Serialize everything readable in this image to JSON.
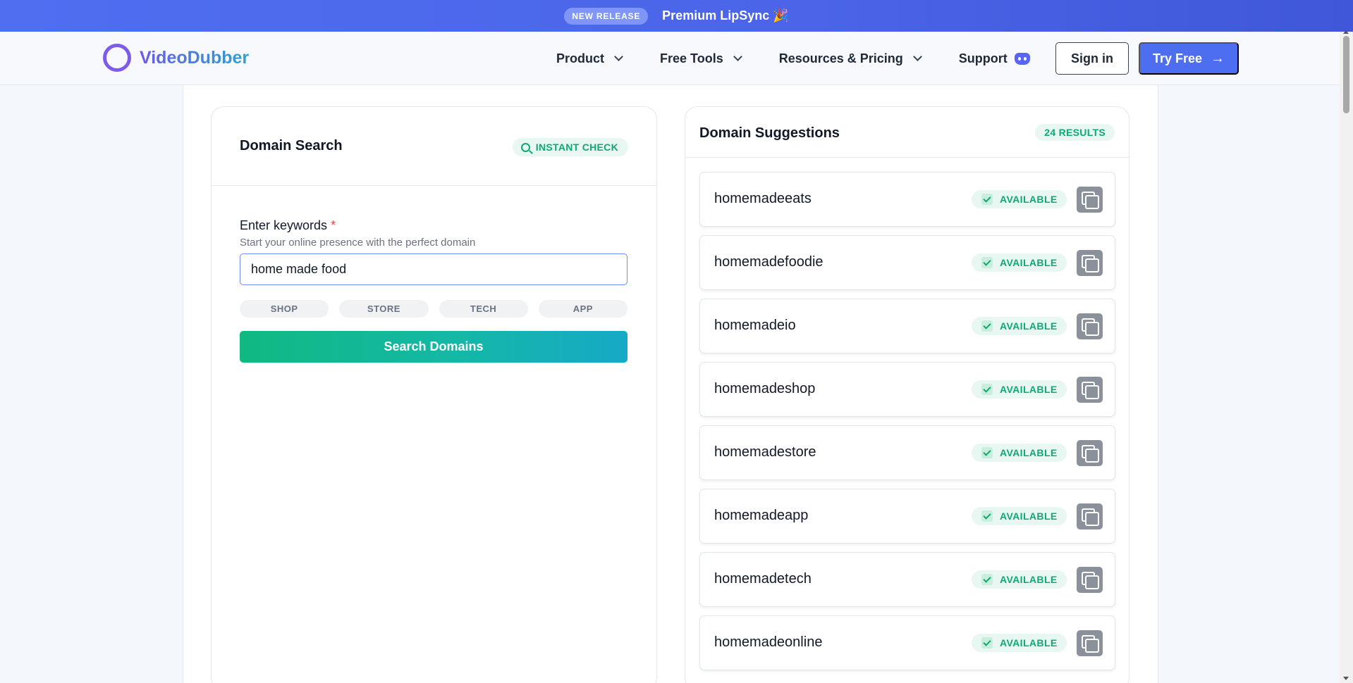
{
  "announcement": {
    "badge": "NEW RELEASE",
    "message": "Premium LipSync 🎉"
  },
  "header": {
    "brand": "VideoDubber",
    "nav": [
      {
        "label": "Product",
        "icon": "chevron-down-icon"
      },
      {
        "label": "Free Tools",
        "icon": "chevron-down-icon"
      },
      {
        "label": "Resources & Pricing",
        "icon": "chevron-down-icon"
      },
      {
        "label": "Support",
        "icon": "discord-icon"
      }
    ],
    "signin_label": "Sign in",
    "tryfree_label": "Try Free"
  },
  "search_panel": {
    "title": "Domain Search",
    "badge": "INSTANT CHECK",
    "field_label": "Enter keywords",
    "required_mark": "*",
    "helper": "Start your online presence with the perfect domain",
    "input_value": "home made food",
    "chips": [
      "SHOP",
      "STORE",
      "TECH",
      "APP"
    ],
    "button_label": "Search Domains"
  },
  "suggestions": {
    "title": "Domain Suggestions",
    "count_label": "24 RESULTS",
    "items": [
      {
        "name": "homemadeeats",
        "status": "AVAILABLE"
      },
      {
        "name": "homemadefoodie",
        "status": "AVAILABLE"
      },
      {
        "name": "homemadeio",
        "status": "AVAILABLE"
      },
      {
        "name": "homemadeshop",
        "status": "AVAILABLE"
      },
      {
        "name": "homemadestore",
        "status": "AVAILABLE"
      },
      {
        "name": "homemadeapp",
        "status": "AVAILABLE"
      },
      {
        "name": "homemadetech",
        "status": "AVAILABLE"
      },
      {
        "name": "homemadeonline",
        "status": "AVAILABLE"
      }
    ]
  },
  "colors": {
    "accent": "#4d6ef0",
    "success": "#10a874",
    "brand_purple": "#7c5ce8"
  }
}
